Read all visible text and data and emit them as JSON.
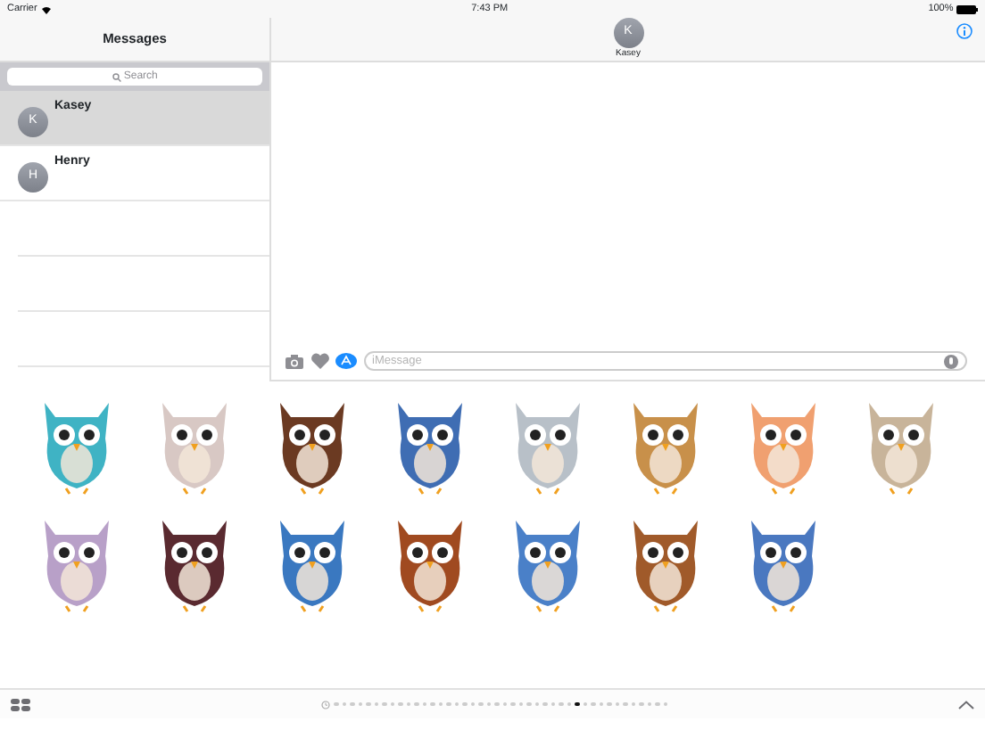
{
  "status_bar": {
    "carrier": "Carrier",
    "time": "7:43 PM",
    "battery": "100%"
  },
  "sidebar": {
    "title": "Messages",
    "search": {
      "placeholder": "Search"
    },
    "conversations": [
      {
        "initial": "K",
        "name": "Kasey",
        "selected": true
      },
      {
        "initial": "H",
        "name": "Henry",
        "selected": false
      }
    ]
  },
  "conversation": {
    "initial": "K",
    "name": "Kasey"
  },
  "compose": {
    "placeholder": "iMessage"
  },
  "stickers": [
    {
      "color": "#3fb3c4"
    },
    {
      "color": "#d8c8c4"
    },
    {
      "color": "#6b3a22"
    },
    {
      "color": "#3f6db3"
    },
    {
      "color": "#b8c0c8"
    },
    {
      "color": "#c8904a"
    },
    {
      "color": "#f0a070"
    },
    {
      "color": "#c8b49a"
    },
    {
      "color": "#b8a0c8"
    },
    {
      "color": "#5a2a30"
    },
    {
      "color": "#3a78c0"
    },
    {
      "color": "#a04a20"
    },
    {
      "color": "#4a80c8"
    },
    {
      "color": "#a05a2a"
    },
    {
      "color": "#4a78c0"
    }
  ],
  "page_dots": [
    {
      "selected": false
    },
    {
      "selected": false
    },
    {
      "selected": false
    },
    {
      "selected": false
    },
    {
      "selected": false
    },
    {
      "selected": false
    },
    {
      "selected": false
    },
    {
      "selected": false
    },
    {
      "selected": false
    },
    {
      "selected": false
    },
    {
      "selected": false
    },
    {
      "selected": false
    },
    {
      "selected": false
    },
    {
      "selected": false
    },
    {
      "selected": false
    },
    {
      "selected": false
    },
    {
      "selected": false
    },
    {
      "selected": false
    },
    {
      "selected": false
    },
    {
      "selected": false
    },
    {
      "selected": false
    },
    {
      "selected": false
    },
    {
      "selected": false
    },
    {
      "selected": false
    },
    {
      "selected": false
    },
    {
      "selected": false
    },
    {
      "selected": false
    },
    {
      "selected": false
    },
    {
      "selected": false
    },
    {
      "selected": false
    },
    {
      "selected": true
    },
    {
      "selected": false
    },
    {
      "selected": false
    },
    {
      "selected": false
    },
    {
      "selected": false
    },
    {
      "selected": false
    },
    {
      "selected": false
    },
    {
      "selected": false
    },
    {
      "selected": false
    },
    {
      "selected": false
    },
    {
      "selected": false
    },
    {
      "selected": false
    }
  ]
}
